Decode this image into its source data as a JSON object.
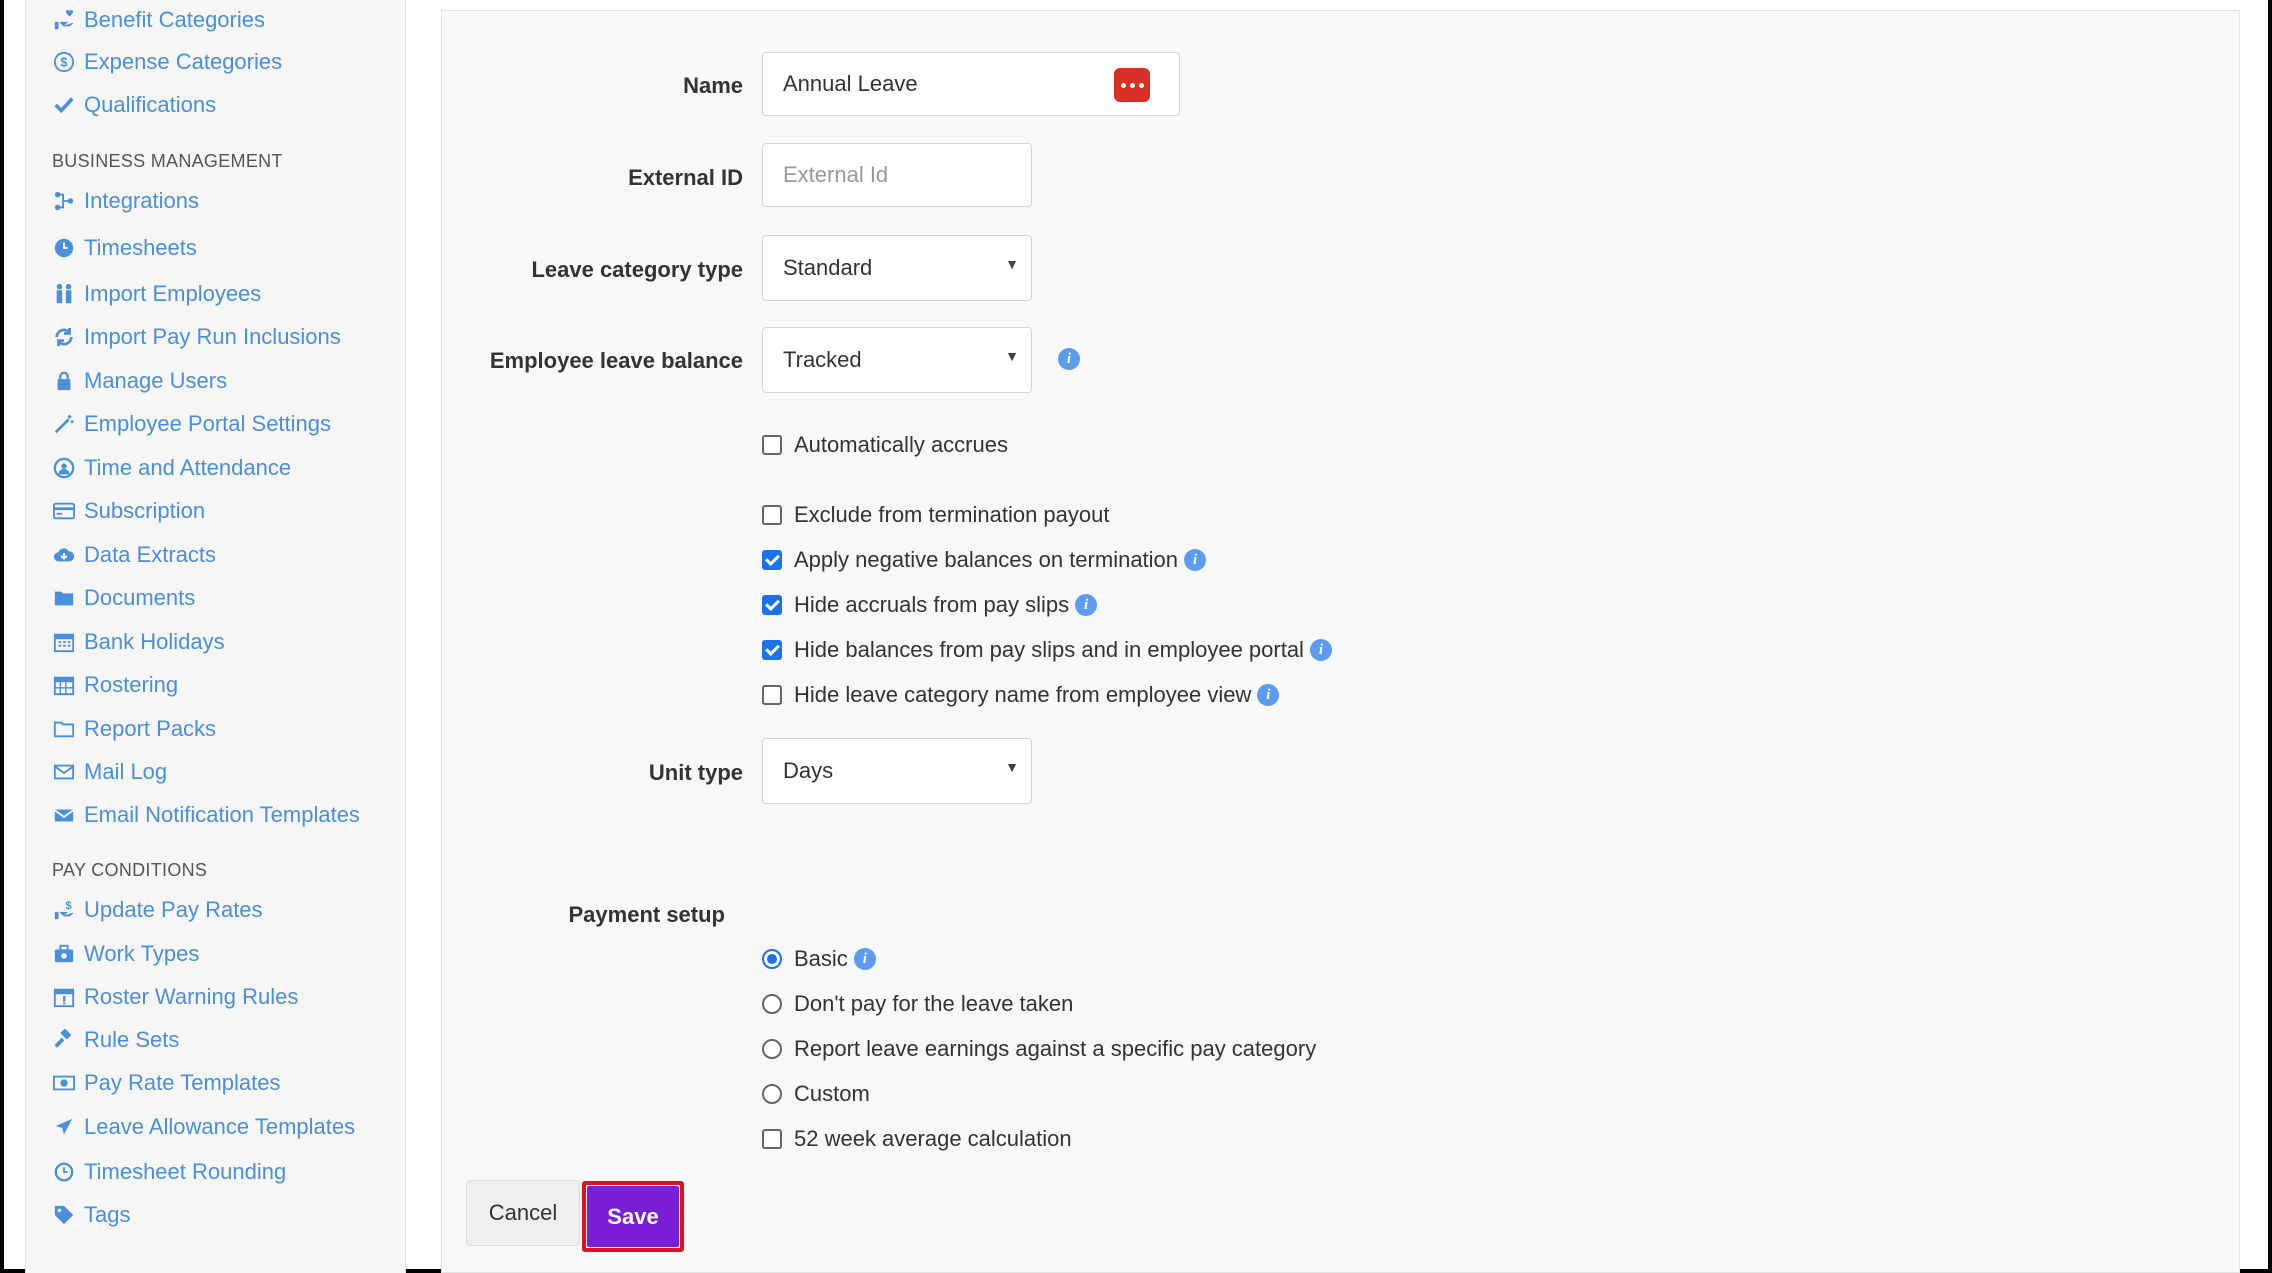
{
  "sidebar": {
    "items_top": [
      {
        "label": "Benefit Categories",
        "icon": "hand-heart-icon"
      },
      {
        "label": "Expense Categories",
        "icon": "dollar-circle-icon"
      },
      {
        "label": "Qualifications",
        "icon": "check-icon"
      }
    ],
    "section_business": "BUSINESS MANAGEMENT",
    "items_business": [
      {
        "label": "Integrations",
        "icon": "integrations-icon"
      },
      {
        "label": "Timesheets",
        "icon": "clock-icon"
      },
      {
        "label": "Import Employees",
        "icon": "people-icon"
      },
      {
        "label": "Import Pay Run Inclusions",
        "icon": "refresh-icon"
      },
      {
        "label": "Manage Users",
        "icon": "lock-icon"
      },
      {
        "label": "Employee Portal Settings",
        "icon": "wand-icon"
      },
      {
        "label": "Time and Attendance",
        "icon": "clock-user-icon"
      },
      {
        "label": "Subscription",
        "icon": "credit-card-icon"
      },
      {
        "label": "Data Extracts",
        "icon": "cloud-download-icon"
      },
      {
        "label": "Documents",
        "icon": "folder-icon"
      },
      {
        "label": "Bank Holidays",
        "icon": "calendar-icon"
      },
      {
        "label": "Rostering",
        "icon": "calendar-grid-icon"
      },
      {
        "label": "Report Packs",
        "icon": "folder-outline-icon"
      },
      {
        "label": "Mail Log",
        "icon": "envelope-icon"
      },
      {
        "label": "Email Notification Templates",
        "icon": "envelope-open-icon"
      }
    ],
    "section_pay": "PAY CONDITIONS",
    "items_pay": [
      {
        "label": "Update Pay Rates",
        "icon": "hand-money-icon"
      },
      {
        "label": "Work Types",
        "icon": "briefcase-icon"
      },
      {
        "label": "Roster Warning Rules",
        "icon": "calendar-alert-icon"
      },
      {
        "label": "Rule Sets",
        "icon": "gavel-icon"
      },
      {
        "label": "Pay Rate Templates",
        "icon": "money-icon"
      },
      {
        "label": "Leave Allowance Templates",
        "icon": "plane-icon"
      },
      {
        "label": "Timesheet Rounding",
        "icon": "clock-outline-icon"
      },
      {
        "label": "Tags",
        "icon": "tag-icon"
      }
    ]
  },
  "form": {
    "name_label": "Name",
    "name_value": "Annual Leave",
    "external_id_label": "External ID",
    "external_id_placeholder": "External Id",
    "leave_category_type_label": "Leave category type",
    "leave_category_type_value": "Standard",
    "employee_leave_balance_label": "Employee leave balance",
    "employee_leave_balance_value": "Tracked",
    "checkboxes": [
      {
        "label": "Automatically accrues",
        "checked": false
      },
      {
        "label": "Exclude from termination payout",
        "checked": false
      },
      {
        "label": "Apply negative balances on termination",
        "checked": true
      },
      {
        "label": "Hide accruals from pay slips",
        "checked": true
      },
      {
        "label": "Hide balances from pay slips and in employee portal",
        "checked": true
      },
      {
        "label": "Hide leave category name from employee view",
        "checked": false
      }
    ],
    "unit_type_label": "Unit type",
    "unit_type_value": "Days",
    "payment_setup_label": "Payment setup",
    "payment_options": [
      {
        "label": "Basic",
        "selected": true
      },
      {
        "label": "Don't pay for the leave taken",
        "selected": false
      },
      {
        "label": "Report leave earnings against a specific pay category",
        "selected": false
      },
      {
        "label": "Custom",
        "selected": false
      }
    ],
    "week_average_label": "52 week average calculation",
    "week_average_checked": false
  },
  "actions": {
    "cancel_label": "Cancel",
    "save_label": "Save"
  },
  "colors": {
    "link": "#4a8fd9",
    "save": "#7a1fd6",
    "highlight": "#e0101f",
    "check": "#1a73e8"
  }
}
